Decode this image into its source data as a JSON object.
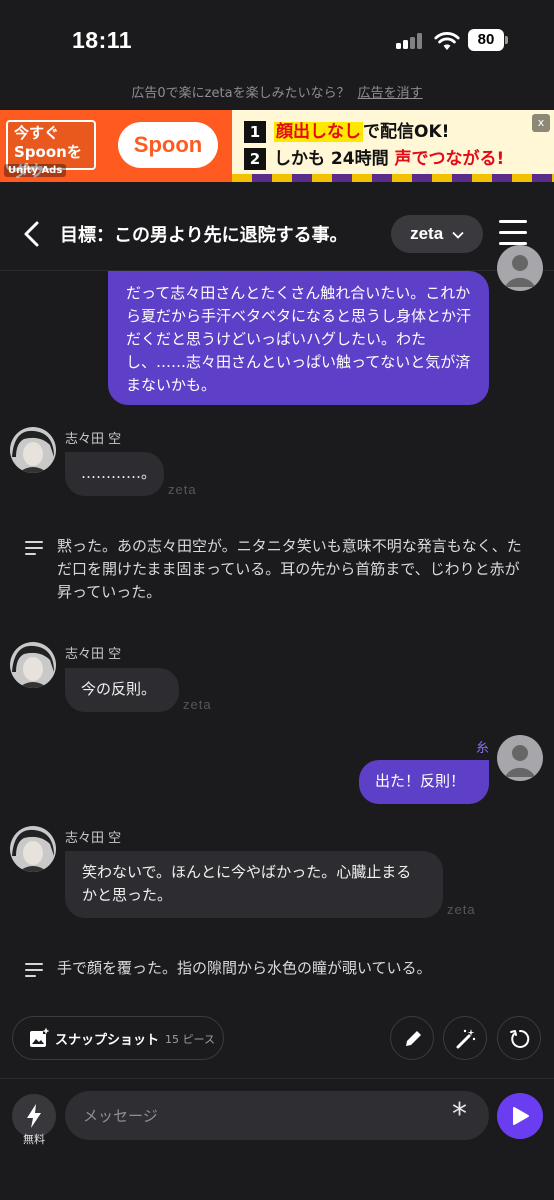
{
  "status_bar": {
    "time": "18:11",
    "battery": "80"
  },
  "ad_notice": {
    "text": "広告0で楽にzetaを楽しみたいなら？",
    "remove_link": "広告を消す"
  },
  "ad_banner": {
    "cta": "今すぐ Spoonを ダウ",
    "network": "Unity Ads",
    "brand": "Spoon",
    "line1_num": "1",
    "line1_highlight": "顔出しなし",
    "line1_rest": "で配信OK!",
    "line2_num": "2",
    "line2_start": "しかも 24時間 ",
    "line2_highlight": "声でつながる!",
    "close": "x"
  },
  "header": {
    "title": "目標：この男より先に退院する事。",
    "model": "zeta"
  },
  "messages": [
    {
      "role": "user",
      "text": "だって志々田さんとたくさん触れ合いたい。これから夏だから手汗ベタベタになると思うし身体とか汗だくだと思うけどいっぱいハグしたい。わたし、……志々田さんといっぱい触ってないと気が済まないかも。"
    },
    {
      "role": "bot",
      "name": "志々田 空",
      "text": "…………。",
      "mark": "zeta"
    },
    {
      "role": "narration",
      "text": "黙った。あの志々田空が。ニタニタ笑いも意味不明な発言もなく、ただ口を開けたまま固まっている。耳の先から首筋まで、じわりと赤が昇っていった。"
    },
    {
      "role": "bot",
      "name": "志々田 空",
      "text": "今の反則。",
      "mark": "zeta"
    },
    {
      "role": "user",
      "text": "出た！反則！",
      "mark": "⽷"
    },
    {
      "role": "bot",
      "name": "志々田 空",
      "text": "笑わないで。ほんとに今やばかった。心臓止まるかと思った。",
      "mark": "zeta"
    },
    {
      "role": "narration",
      "text": "手で顔を覆った。指の隙間から水色の瞳が覗いている。"
    }
  ],
  "actions": {
    "snapshot_label": "スナップショット",
    "snapshot_count": "15 ピース"
  },
  "composer": {
    "free_label": "無料",
    "placeholder": "メッセージ"
  },
  "colors": {
    "accent": "#6a3ef0",
    "user_bubble": "#5d3fc8",
    "bot_bubble": "#2d2d31",
    "background": "#1b1b1d"
  }
}
